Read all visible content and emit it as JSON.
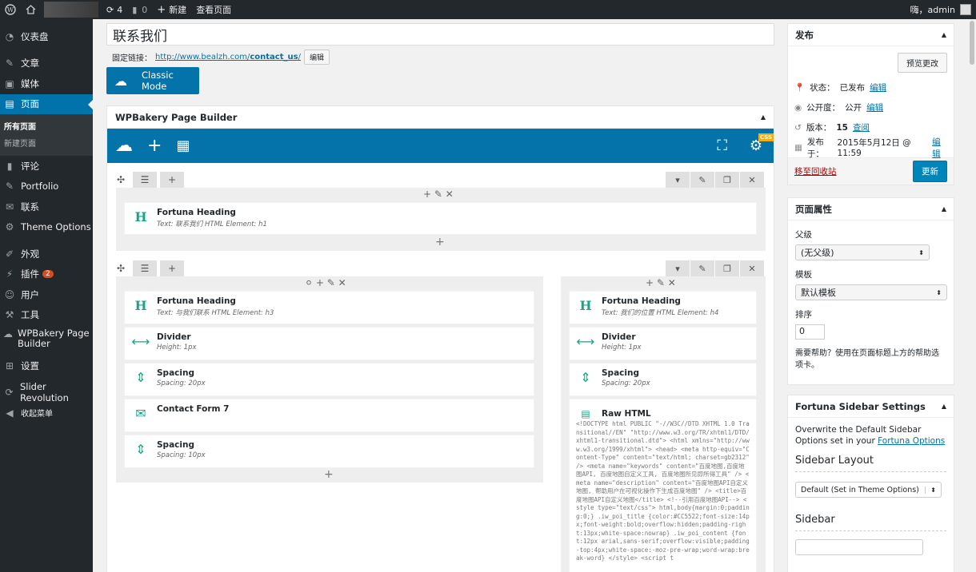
{
  "adminbar": {
    "updates": "4",
    "comments": "0",
    "new": "新建",
    "view": "查看页面",
    "greeting": "嗨，admin"
  },
  "sidebar": {
    "items": [
      {
        "label": "仪表盘",
        "icon": "dashboard-icon"
      },
      {
        "label": "文章",
        "icon": "pin-icon"
      },
      {
        "label": "媒体",
        "icon": "media-icon"
      },
      {
        "label": "页面",
        "icon": "pages-icon"
      },
      {
        "label": "评论",
        "icon": "comments-icon"
      },
      {
        "label": "Portfolio",
        "icon": "pin-icon"
      },
      {
        "label": "联系",
        "icon": "mail-icon"
      },
      {
        "label": "Theme Options",
        "icon": "gear-icon"
      },
      {
        "label": "外观",
        "icon": "brush-icon"
      },
      {
        "label": "插件",
        "icon": "plugin-icon"
      },
      {
        "label": "用户",
        "icon": "user-icon"
      },
      {
        "label": "工具",
        "icon": "wrench-icon"
      },
      {
        "label": "WPBakery Page Builder",
        "icon": "cloud-icon"
      },
      {
        "label": "设置",
        "icon": "settings-icon"
      },
      {
        "label": "Slider Revolution",
        "icon": "refresh-icon"
      },
      {
        "label": "收起菜单",
        "icon": "collapse-icon"
      }
    ],
    "plugins_badge": "2",
    "submenu": {
      "all": "所有页面",
      "new": "新建页面"
    }
  },
  "editor": {
    "title": "联系我们",
    "permalink_label": "固定链接：",
    "permalink_base": "http://www.bealzh.com/",
    "permalink_slug": "contact_us",
    "permalink_end": "/",
    "edit": "编辑",
    "classic_mode": "Classic Mode"
  },
  "wpb": {
    "title": "WPBakery Page Builder",
    "css_tag": "CSS",
    "row1": {
      "heading_title": "Fortuna Heading",
      "heading_sub": "Text: 联系我们 HTML Element: h1"
    },
    "col_left": [
      {
        "title": "Fortuna Heading",
        "sub": "Text: 与我们联系 HTML Element: h3",
        "icon": "heading-icon"
      },
      {
        "title": "Divider",
        "sub": "Height: 1px",
        "icon": "divider-icon"
      },
      {
        "title": "Spacing",
        "sub": "Spacing: 20px",
        "icon": "spacing-icon"
      },
      {
        "title": "Contact Form 7",
        "sub": "",
        "icon": "mail-icon"
      },
      {
        "title": "Spacing",
        "sub": "Spacing: 10px",
        "icon": "spacing-icon"
      }
    ],
    "col_right": [
      {
        "title": "Fortuna Heading",
        "sub": "Text: 我们的位置 HTML Element: h4",
        "icon": "heading-icon"
      },
      {
        "title": "Divider",
        "sub": "Height: 1px",
        "icon": "divider-icon"
      },
      {
        "title": "Spacing",
        "sub": "Spacing: 20px",
        "icon": "spacing-icon"
      },
      {
        "title": "Raw HTML",
        "sub": "",
        "icon": "html-icon"
      }
    ],
    "raw_code": "<!DOCTYPE html PUBLIC \"-//W3C//DTD XHTML 1.0 Transitional//EN\" \"http://www.w3.org/TR/xhtml1/DTD/xhtml1-transitional.dtd\"> <html xmlns=\"http://www.w3.org/1999/xhtml\"> <head> <meta http-equiv=\"Content-Type\" content=\"text/html; charset=gb2312\" /> <meta name=\"keywords\" content=\"百度地图,百度地图API, 百度地图自定义工具, 百度地图所见即所得工具\" /> <meta name=\"description\" content=\"百度地图API自定义地图, 帮助用户在可视化操作下生成百度地图\" /> <title>百度地图API自定义地图</title> <!--引用百度地图API--> <style type=\"text/css\"> html,body{margin:0;padding:0;} .iw_poi_title {color:#CC5522;font-size:14px;font-weight:bold;overflow:hidden;padding-right:13px;white-space:nowrap} .iw_poi_content {font:12px arial,sans-serif;overflow:visible;padding-top:4px;white-space:-moz-pre-wrap;word-wrap:break-word} </style> <script t"
  },
  "publish": {
    "title": "发布",
    "preview": "预览更改",
    "status_label": "状态：",
    "status_value": "已发布",
    "visibility_label": "公开度：",
    "visibility_value": "公开",
    "revisions_label": "版本：",
    "revisions_value": "15",
    "revisions_link": "查阅",
    "published_label": "发布于：",
    "published_value": "2015年5月12日 @ 11:59",
    "edit": "编辑",
    "trash": "移至回收站",
    "update": "更新"
  },
  "page_attrs": {
    "title": "页面属性",
    "parent_label": "父级",
    "parent_value": "(无父级)",
    "template_label": "模板",
    "template_value": "默认模板",
    "order_label": "排序",
    "order_value": "0",
    "help": "需要帮助？使用在页面标题上方的帮助选项卡。"
  },
  "fortuna": {
    "title": "Fortuna Sidebar Settings",
    "desc": "Overwrite the Default Sidebar Options set in your",
    "link": "Fortuna Options",
    "layout_title": "Sidebar Layout",
    "layout_value": "Default (Set in Theme Options)",
    "sidebar_title": "Sidebar"
  }
}
